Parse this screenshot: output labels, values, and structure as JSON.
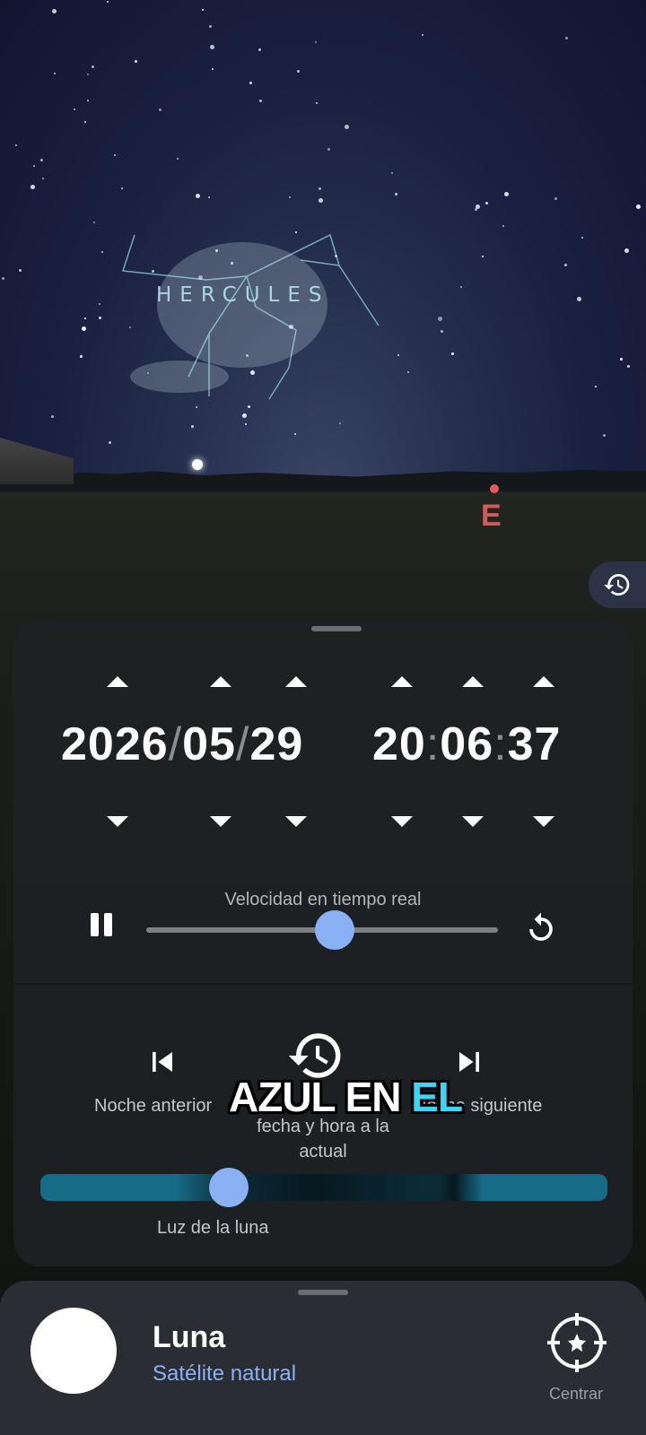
{
  "sky": {
    "constellation_label": "HERCULES",
    "compass_label": "E"
  },
  "time_panel": {
    "date": {
      "year": "2026",
      "month": "05",
      "day": "29",
      "separator": "/"
    },
    "time": {
      "hour": "20",
      "minute": "06",
      "second": "37",
      "separator": ":"
    },
    "speed_label": "Velocidad en tiempo real",
    "speed_level": 0.5,
    "prev_night_label": "Noche anterior",
    "reset_label": "fecha y hora a la actual",
    "next_night_label": "Noche siguiente",
    "moonlight_label": "Luz de la luna",
    "moonlight_level": 0.34
  },
  "overlay_caption": {
    "part1": "AZUL EN ",
    "part2": "EL"
  },
  "object_sheet": {
    "name": "Luna",
    "type": "Satélite natural",
    "center_label": "Centrar"
  },
  "colors": {
    "accent": "#8ab1f3",
    "compass_red": "#d45a5a",
    "constellation": "#a8d8de",
    "caption_highlight": "#3cd6f4"
  },
  "icons": [
    "history-icon",
    "pause-icon",
    "reset-icon",
    "skip-previous-icon",
    "restore-time-icon",
    "skip-next-icon",
    "crosshair-icon"
  ]
}
